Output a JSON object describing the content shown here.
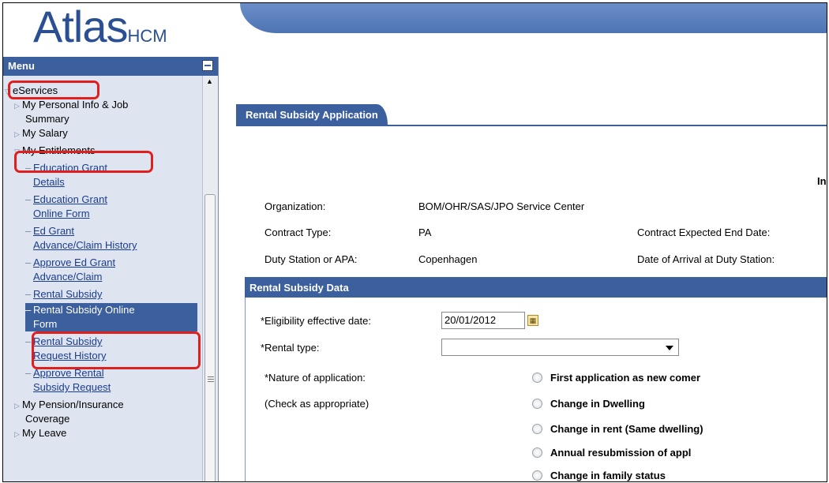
{
  "header": {
    "logo_main": "Atlas",
    "logo_sub": "HCM"
  },
  "menu": {
    "title": "Menu",
    "items": [
      {
        "label": "eServices"
      },
      {
        "label": "My Personal Info & Job"
      },
      {
        "label": "Summary"
      },
      {
        "label": "My Salary"
      },
      {
        "label": "My Entitlements"
      },
      {
        "label": "Education Grant"
      },
      {
        "label": "Details"
      },
      {
        "label": "Education Grant"
      },
      {
        "label": "Online Form"
      },
      {
        "label": "Ed Grant"
      },
      {
        "label": "Advance/Claim History"
      },
      {
        "label": "Approve Ed Grant"
      },
      {
        "label": "Advance/Claim"
      },
      {
        "label": "Rental Subsidy"
      },
      {
        "label": "Rental Subsidy Online"
      },
      {
        "label": "Form"
      },
      {
        "label": "Rental Subsidy"
      },
      {
        "label": "Request History"
      },
      {
        "label": "Approve Rental"
      },
      {
        "label": "Subsidy Request"
      },
      {
        "label": "My Pension/Insurance"
      },
      {
        "label": "Coverage"
      },
      {
        "label": "My Leave"
      }
    ]
  },
  "tab": {
    "label": "Rental Subsidy Application"
  },
  "info": {
    "ind_label": "In",
    "org_label": "Organization:",
    "org_value": "BOM/OHR/SAS/JPO Service Center",
    "contract_label": "Contract Type:",
    "contract_value": "PA",
    "contract_end_label": "Contract Expected End Date:",
    "duty_label": "Duty Station or APA:",
    "duty_value": "Copenhagen",
    "arrival_label": "Date of Arrival at Duty Station:"
  },
  "section": {
    "title": "Rental Subsidy Data",
    "eligibility_label": "*Eligibility effective date:",
    "eligibility_value": "20/01/2012",
    "calendar_icon": "calendar-icon",
    "rental_type_label": "*Rental type:",
    "rental_type_value": "",
    "nature_label": "*Nature of application:",
    "nature_hint": "(Check as appropriate)",
    "options": [
      {
        "label": "First application as new comer",
        "checked": false
      },
      {
        "label": "Change in Dwelling",
        "checked": false
      },
      {
        "label": "Change in rent (Same dwelling)",
        "checked": false
      },
      {
        "label": "Annual resubmission of appl",
        "checked": false
      },
      {
        "label": "Change in family status",
        "checked": false
      }
    ]
  }
}
